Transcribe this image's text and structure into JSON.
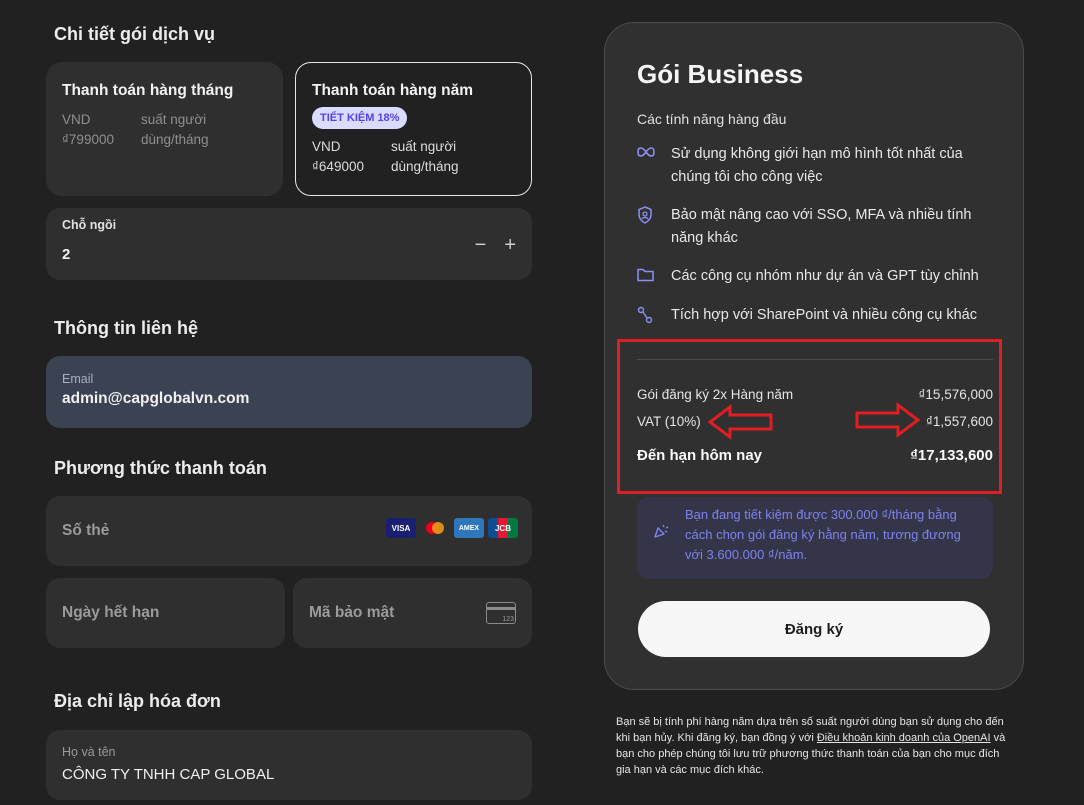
{
  "sections": {
    "plan_details": "Chi tiết gói dịch vụ",
    "contact": "Thông tin liên hệ",
    "payment": "Phương thức thanh toán",
    "billing": "Địa chỉ lập hóa đơn"
  },
  "plans": {
    "monthly": {
      "name": "Thanh toán hàng tháng",
      "currency": "VND",
      "price": "₫799000",
      "per_user": "suất người",
      "per_month": "dùng/tháng"
    },
    "yearly": {
      "name": "Thanh toán hàng năm",
      "badge": "TIẾT KIỆM 18%",
      "currency": "VND",
      "price": "₫649000",
      "per_user": "suất người",
      "per_month": "dùng/tháng"
    }
  },
  "seats": {
    "label": "Chỗ ngồi",
    "value": "2",
    "minus": "−",
    "plus": "+"
  },
  "email": {
    "label": "Email",
    "value": "admin@capglobalvn.com"
  },
  "payment": {
    "card_number": "Số thẻ",
    "expiry": "Ngày hết hạn",
    "cvc": "Mã bảo mật",
    "cvc_hint": "123",
    "brands": [
      "VISA",
      "MC",
      "AMEX",
      "JCB"
    ]
  },
  "billing": {
    "name_label": "Họ và tên",
    "name_value": "CÔNG TY TNHH CAP GLOBAL"
  },
  "summary": {
    "title": "Gói Business",
    "subtitle": "Các tính năng hàng đầu",
    "features": [
      {
        "icon": "infinity-icon",
        "text": "Sử dụng không giới hạn mô hình tốt nhất của chúng tôi cho công việc"
      },
      {
        "icon": "shield-icon",
        "text": "Bảo mật nâng cao với SSO, MFA và nhiều tính năng khác"
      },
      {
        "icon": "folder-icon",
        "text": "Các công cụ nhóm như dự án và GPT tùy chỉnh"
      },
      {
        "icon": "link-icon",
        "text": "Tích hợp với SharePoint và nhiều công cụ khác"
      }
    ],
    "line_item_label": "Gói đăng ký 2x Hàng năm",
    "line_item_value": "₫15,576,000",
    "vat_label": "VAT (10%)",
    "vat_value": "₫1,557,600",
    "total_label": "Đến hạn hôm nay",
    "total_value": "₫17,133,600",
    "savings_text": "Bạn đang tiết kiệm được 300.000 ₫/tháng bằng cách chọn gói đăng ký hằng năm, tương đương với 3.600.000 ₫/năm.",
    "subscribe_label": "Đăng ký"
  },
  "legal": {
    "part1": "Bạn sẽ bị tính phí hàng năm dựa trên số suất người dùng bạn sử dụng cho đến khi bạn hủy. Khi đăng ký, bạn đồng ý với ",
    "link": "Điều khoản kinh doanh của OpenAI",
    "part2": " và bạn cho phép chúng tôi lưu trữ phương thức thanh toán của bạn cho mục đích gia hạn và các mục đích khác."
  },
  "colors": {
    "accent": "#8b8ff5",
    "annotation": "#e01e24",
    "badge_bg": "#d9dbff"
  }
}
